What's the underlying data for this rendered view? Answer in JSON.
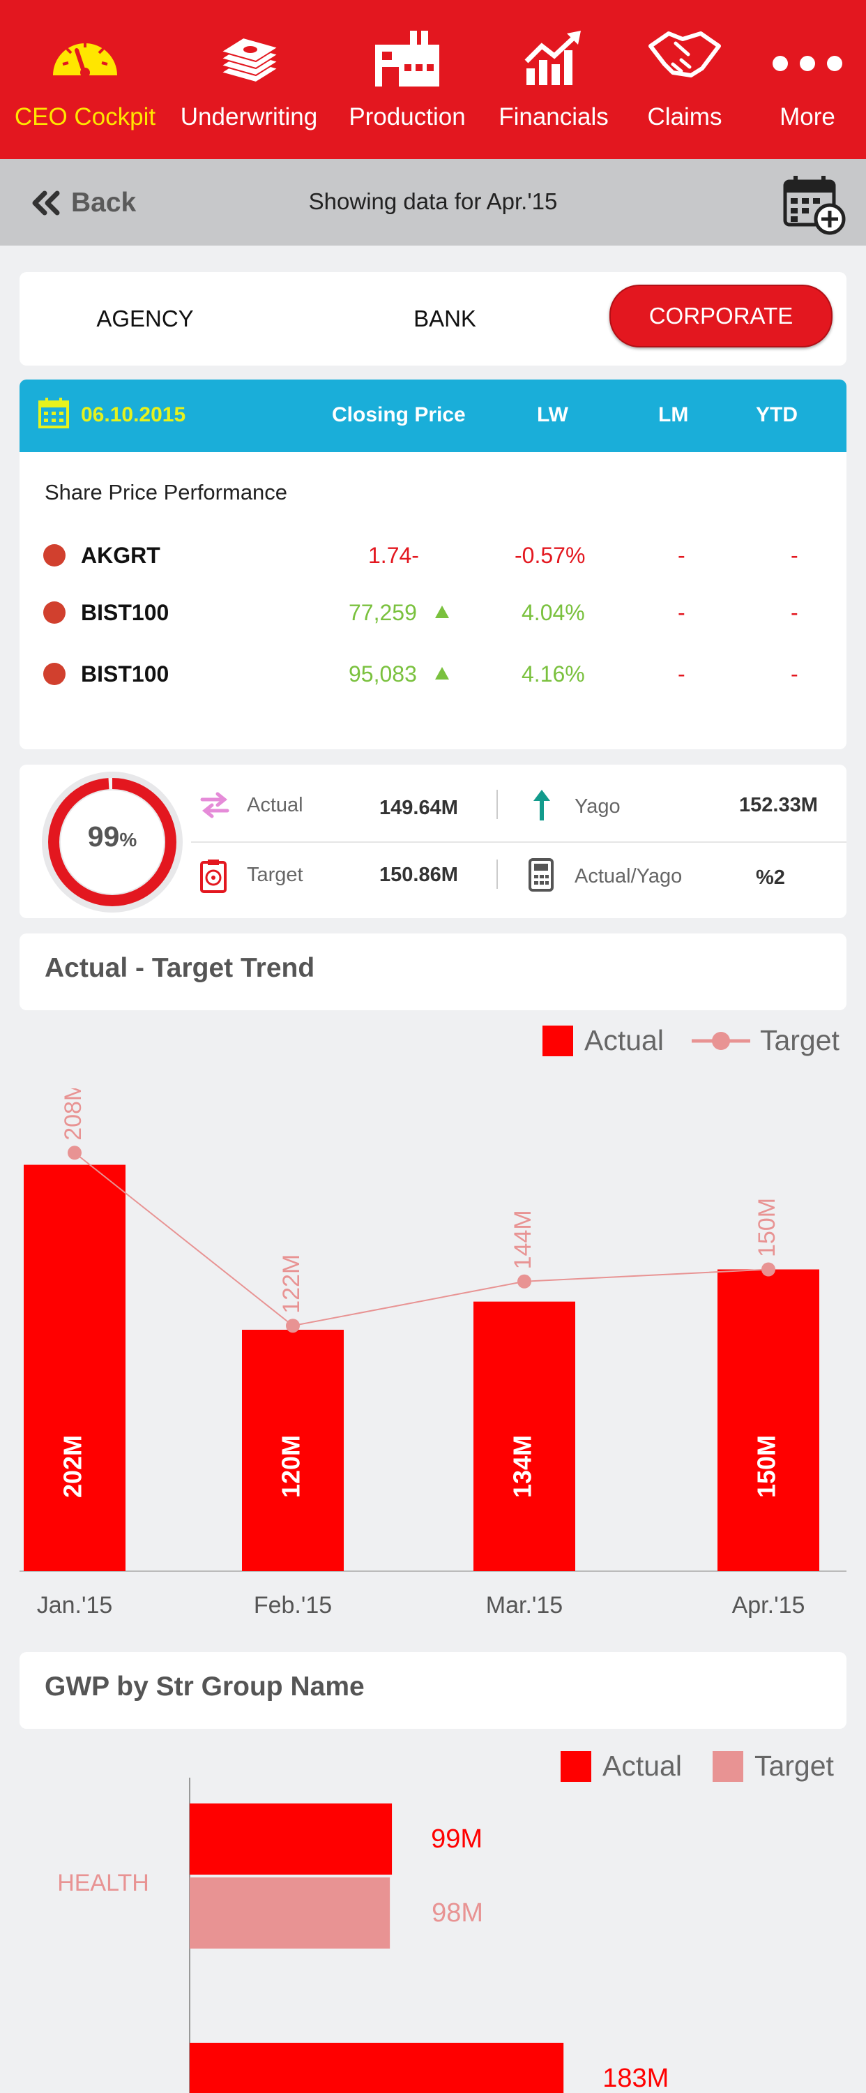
{
  "nav": {
    "items": [
      {
        "label": "CEO Cockpit",
        "icon": "gauge-icon"
      },
      {
        "label": "Underwriting",
        "icon": "money-stack-icon"
      },
      {
        "label": "Production",
        "icon": "factory-icon"
      },
      {
        "label": "Financials",
        "icon": "growth-chart-icon"
      },
      {
        "label": "Claims",
        "icon": "handshake-icon"
      },
      {
        "label": "More",
        "icon": "more-dots-icon"
      }
    ]
  },
  "subbar": {
    "back_label": "Back",
    "showing": "Showing data for Apr.'15"
  },
  "segments": [
    "AGENCY",
    "BANK",
    "CORPORATE"
  ],
  "share": {
    "date": "06.10.2015",
    "columns": [
      "Closing Price",
      "LW",
      "LM",
      "YTD"
    ],
    "title": "Share Price Performance",
    "rows": [
      {
        "name": "AKGRT",
        "price": "1.74-",
        "lw": "-0.57%",
        "lm": "-",
        "ytd": "-",
        "trend": "down"
      },
      {
        "name": "BIST100",
        "price": "77,259",
        "lw": "4.04%",
        "lm": "-",
        "ytd": "-",
        "trend": "up"
      },
      {
        "name": "BIST100",
        "price": "95,083",
        "lw": "4.16%",
        "lm": "-",
        "ytd": "-",
        "trend": "up"
      }
    ]
  },
  "kpi": {
    "percent": "99",
    "percent_sign": "%",
    "percent_value": 0.99,
    "actual_label": "Actual",
    "actual_value": "149.64M",
    "target_label": "Target",
    "target_value": "150.86M",
    "yago_label": "Yago",
    "yago_value": "152.33M",
    "ratio_label": "Actual/Yago",
    "ratio_value": "%2"
  },
  "trend_section": {
    "title": "Actual - Target Trend",
    "legend_actual": "Actual",
    "legend_target": "Target"
  },
  "gwp_section": {
    "title": "GWP by Str Group Name",
    "legend_actual": "Actual",
    "legend_target": "Target"
  },
  "colors": {
    "brand": "#e3171f",
    "bar": "#ff0000",
    "target": "#e89393",
    "up": "#7ac13e",
    "header": "#1aaed9",
    "date": "#e6f21d"
  },
  "chart_data": [
    {
      "type": "bar",
      "title": "Actual - Target Trend",
      "categories": [
        "Jan.'15",
        "Feb.'15",
        "Mar.'15",
        "Apr.'15"
      ],
      "series": [
        {
          "name": "Actual",
          "type": "bar",
          "values": [
            202,
            120,
            134,
            150
          ],
          "labels": [
            "202M",
            "120M",
            "134M",
            "150M"
          ]
        },
        {
          "name": "Target",
          "type": "line",
          "values": [
            208,
            122,
            144,
            150
          ],
          "labels": [
            "208M",
            "122M",
            "144M",
            "150M"
          ]
        }
      ],
      "ylim": [
        0,
        240
      ],
      "legend": "top-right",
      "grid": false
    },
    {
      "type": "bar",
      "orientation": "horizontal",
      "title": "GWP by Str Group Name",
      "categories": [
        "HEALTH",
        ""
      ],
      "series": [
        {
          "name": "Actual",
          "values": [
            99,
            183
          ],
          "labels": [
            "99M",
            "183M"
          ]
        },
        {
          "name": "Target",
          "values": [
            98,
            null
          ],
          "labels": [
            "98M",
            ""
          ]
        }
      ],
      "legend": "top-right"
    }
  ]
}
